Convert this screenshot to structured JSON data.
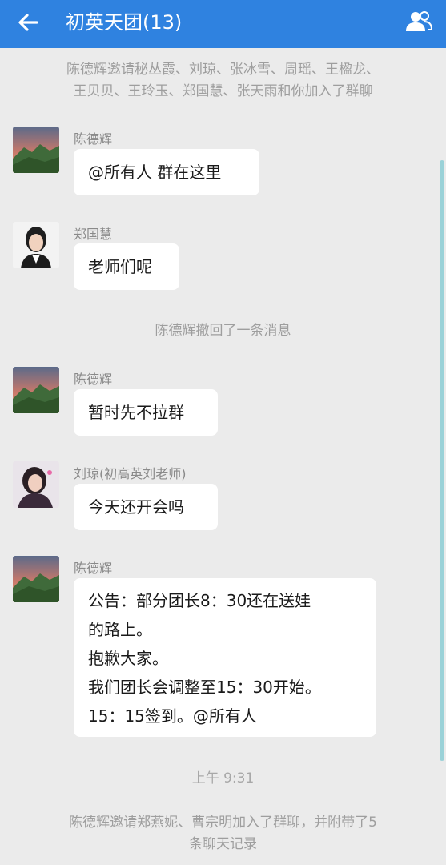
{
  "header": {
    "title": "初英天团(13)",
    "back_icon": "back-arrow-icon",
    "members_icon": "group-members-icon",
    "color": "#2f82e0"
  },
  "messages": {
    "system_invite_1_line1": "陈德辉邀请秘丛霞、刘琼、张冰雪、周瑶、王楹龙、",
    "system_invite_1_line2": "王贝贝、王玲玉、郑国慧、张天雨和你加入了群聊",
    "msg1": {
      "sender": "陈德辉",
      "text": "@所有人 群在这里"
    },
    "msg2": {
      "sender": "郑国慧",
      "text": "老师们呢"
    },
    "system_recall": "陈德辉撤回了一条消息",
    "msg3": {
      "sender": "陈德辉",
      "text": "暂时先不拉群"
    },
    "msg4": {
      "sender": "刘琼(初高英刘老师)",
      "text": "今天还开会吗"
    },
    "msg5": {
      "sender": "陈德辉",
      "lines": [
        "公告：部分团长8：30还在送娃",
        "的路上。",
        "抱歉大家。",
        "我们团长会调整至15：30开始。",
        "15：15签到。@所有人"
      ]
    },
    "timestamp": "上午 9:31",
    "system_invite_2_line1": "陈德辉邀请郑燕妮、曹宗明加入了群聊，并附带了5",
    "system_invite_2_line2": "条聊天记录"
  },
  "avatars": {
    "chen": "landscape-avatar-icon",
    "zheng": "portrait-avatar-icon",
    "liu": "portrait-avatar-icon"
  }
}
